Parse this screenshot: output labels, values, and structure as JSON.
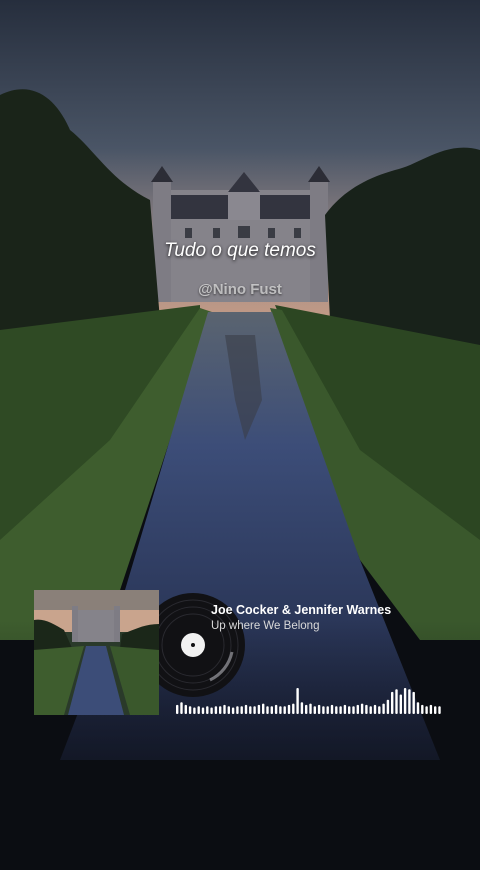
{
  "video": {
    "caption": "Tudo o que temos",
    "watermark": "@Nino Fust"
  },
  "player": {
    "artist": "Joe Cocker & Jennifer Warnes",
    "song_title": "Up where We Belong",
    "cover_icon": "castle-cover-art",
    "disc_icon": "vinyl-record-icon",
    "visualizer_icon": "audio-waveform-icon",
    "visualizer_levels": [
      0.35,
      0.45,
      0.35,
      0.3,
      0.25,
      0.3,
      0.25,
      0.3,
      0.25,
      0.3,
      0.3,
      0.35,
      0.3,
      0.25,
      0.3,
      0.3,
      0.35,
      0.3,
      0.3,
      0.35,
      0.4,
      0.3,
      0.3,
      0.35,
      0.3,
      0.3,
      0.35,
      0.4,
      1.0,
      0.45,
      0.35,
      0.4,
      0.3,
      0.35,
      0.3,
      0.3,
      0.35,
      0.3,
      0.3,
      0.35,
      0.3,
      0.3,
      0.35,
      0.4,
      0.35,
      0.3,
      0.35,
      0.3,
      0.4,
      0.55,
      0.85,
      0.95,
      0.75,
      1.0,
      0.95,
      0.85,
      0.45,
      0.35,
      0.3,
      0.35,
      0.3,
      0.3
    ]
  },
  "colors": {
    "sky_top": "#2f3a4c",
    "sky_glow": "#c79a7e",
    "water": "#3a4a6e",
    "foliage": "#1c2a1c",
    "text": "#ffffff"
  }
}
